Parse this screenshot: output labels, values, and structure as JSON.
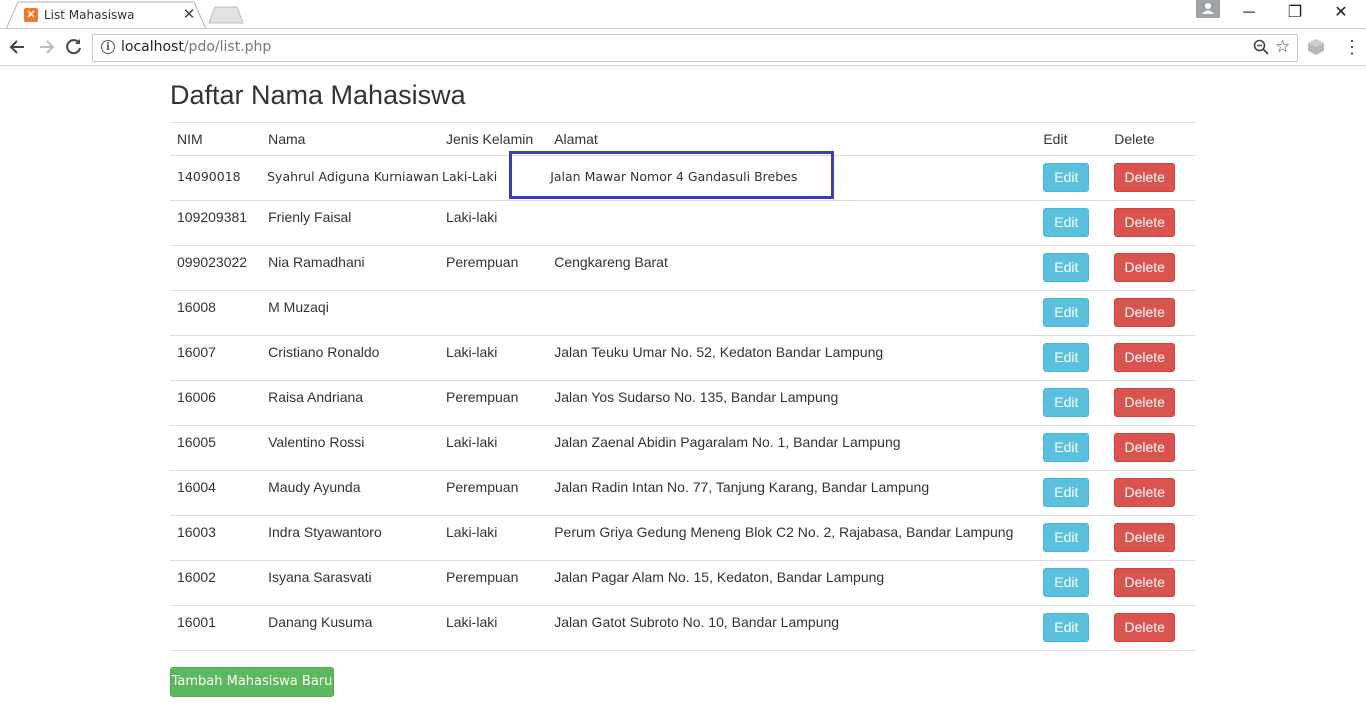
{
  "browser": {
    "tab_title": "List Mahasiswa",
    "url_host": "localhost",
    "url_path": "/pdo/list.php"
  },
  "page": {
    "title": "Daftar Nama Mahasiswa",
    "add_button": "Tambah Mahasiswa Baru"
  },
  "table": {
    "headers": [
      "NIM",
      "Nama",
      "Jenis Kelamin",
      "Alamat",
      "Edit",
      "Delete"
    ],
    "edit_label": "Edit",
    "delete_label": "Delete",
    "rows": [
      {
        "nim": "14090018",
        "nama": "Syahrul Adiguna Kurniawan",
        "jk": "Laki-Laki",
        "alamat": "Jalan Mawar Nomor 4 Gandasuli Brebes"
      },
      {
        "nim": "109209381",
        "nama": "Frienly Faisal",
        "jk": "Laki-laki",
        "alamat": ""
      },
      {
        "nim": "099023022",
        "nama": "Nia Ramadhani",
        "jk": "Perempuan",
        "alamat": "Cengkareng Barat"
      },
      {
        "nim": "16008",
        "nama": "M Muzaqi",
        "jk": "",
        "alamat": ""
      },
      {
        "nim": "16007",
        "nama": "Cristiano Ronaldo",
        "jk": "Laki-laki",
        "alamat": "Jalan Teuku Umar No. 52, Kedaton Bandar Lampung"
      },
      {
        "nim": "16006",
        "nama": "Raisa Andriana",
        "jk": "Perempuan",
        "alamat": "Jalan Yos Sudarso No. 135, Bandar Lampung"
      },
      {
        "nim": "16005",
        "nama": "Valentino Rossi",
        "jk": "Laki-laki",
        "alamat": "Jalan Zaenal Abidin Pagaralam No. 1, Bandar Lampung"
      },
      {
        "nim": "16004",
        "nama": "Maudy Ayunda",
        "jk": "Perempuan",
        "alamat": "Jalan Radin Intan No. 77, Tanjung Karang, Bandar Lampung"
      },
      {
        "nim": "16003",
        "nama": "Indra Styawantoro",
        "jk": "Laki-laki",
        "alamat": "Perum Griya Gedung Meneng Blok C2 No. 2, Rajabasa, Bandar Lampung"
      },
      {
        "nim": "16002",
        "nama": "Isyana Sarasvati",
        "jk": "Perempuan",
        "alamat": "Jalan Pagar Alam No. 15, Kedaton, Bandar Lampung"
      },
      {
        "nim": "16001",
        "nama": "Danang Kusuma",
        "jk": "Laki-laki",
        "alamat": "Jalan Gatot Subroto No. 10, Bandar Lampung"
      }
    ]
  },
  "colors": {
    "edit": "#5bc0de",
    "delete": "#d9534f",
    "add": "#5cb85c",
    "highlight": "#3b3fb0"
  }
}
